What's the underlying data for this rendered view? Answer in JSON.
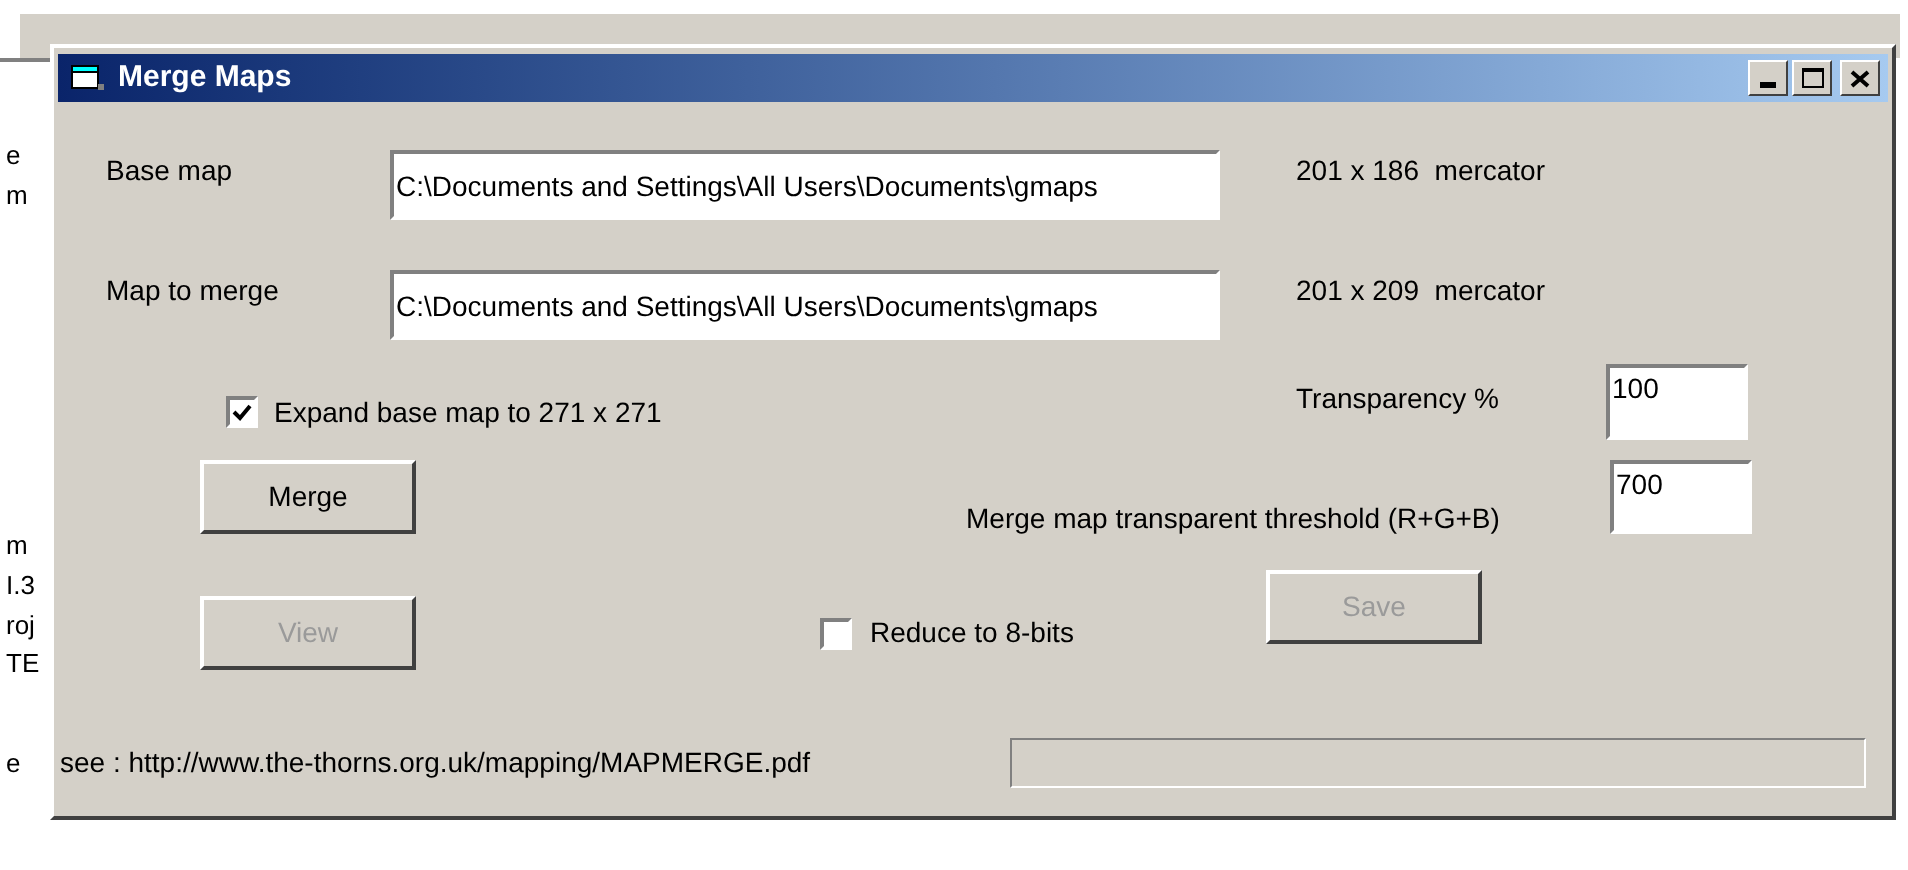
{
  "background_text": [
    "e",
    "m",
    "m",
    "I.3",
    "roj",
    "TE",
    "e"
  ],
  "window": {
    "title": "Merge Maps"
  },
  "fields": [
    {
      "label": "Base map",
      "value": "C:\\Documents and Settings\\All Users\\Documents\\gmaps",
      "info": "201 x 186  mercator"
    },
    {
      "label": "Map to merge",
      "value": "C:\\Documents and Settings\\All Users\\Documents\\gmaps",
      "info": "201 x 209  mercator"
    }
  ],
  "expand_checkbox": {
    "label": "Expand base map to 271 x 271",
    "checked": true
  },
  "transparency": {
    "label": "Transparency %",
    "value": "100"
  },
  "threshold": {
    "label": "Merge map transparent threshold (R+G+B)",
    "value": "700"
  },
  "buttons": [
    {
      "label": "Merge",
      "disabled": false
    },
    {
      "label": "View",
      "disabled": true
    },
    {
      "label": "Save",
      "disabled": true
    }
  ],
  "reduce_checkbox": {
    "label": "Reduce to 8-bits",
    "checked": false
  },
  "status_bar": {
    "link": "see : http://www.the-thorns.org.uk/mapping/MAPMERGE.pdf",
    "progress": {
      "level": 0
    }
  }
}
